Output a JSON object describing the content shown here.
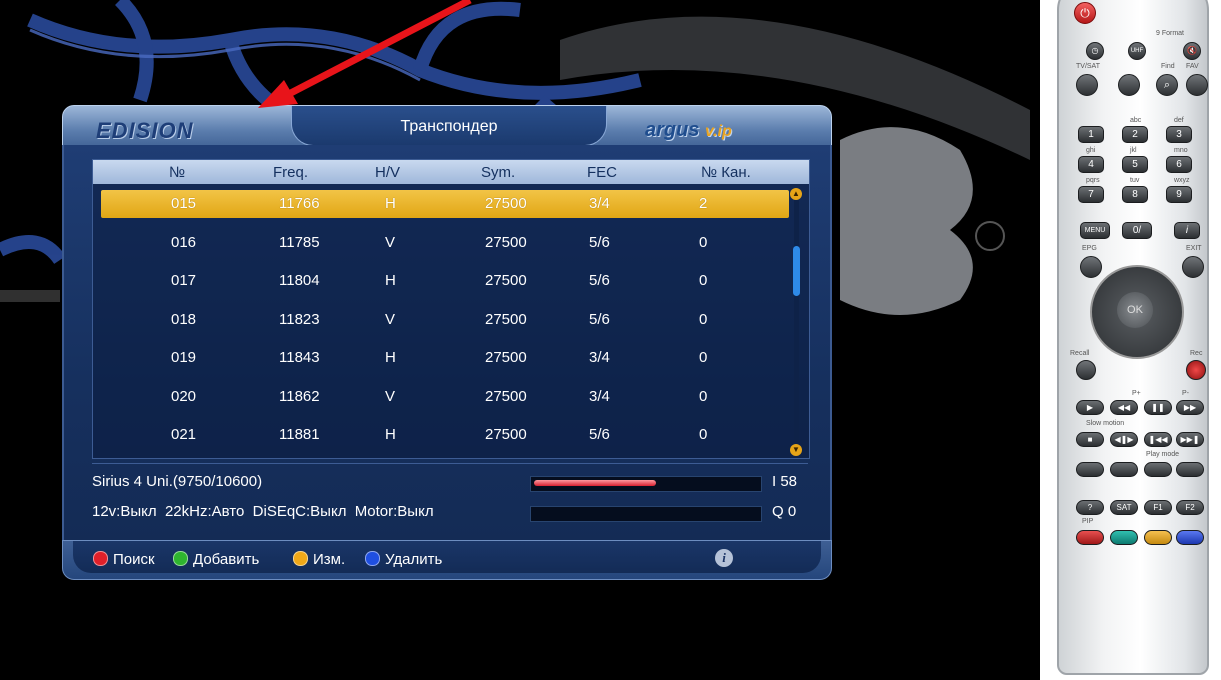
{
  "header": {
    "brand_left": "EDISION",
    "title": "Транспондер",
    "brand_right": "argus",
    "brand_right_suffix": "v.ip"
  },
  "columns": [
    "№",
    "Freq.",
    "H/V",
    "Sym.",
    "FEC",
    "№ Кан."
  ],
  "rows": [
    {
      "num": "015",
      "freq": "11766",
      "pol": "H",
      "sym": "27500",
      "fec": "3/4",
      "ch": "2",
      "selected": true
    },
    {
      "num": "016",
      "freq": "11785",
      "pol": "V",
      "sym": "27500",
      "fec": "5/6",
      "ch": "0"
    },
    {
      "num": "017",
      "freq": "11804",
      "pol": "H",
      "sym": "27500",
      "fec": "5/6",
      "ch": "0"
    },
    {
      "num": "018",
      "freq": "11823",
      "pol": "V",
      "sym": "27500",
      "fec": "5/6",
      "ch": "0"
    },
    {
      "num": "019",
      "freq": "11843",
      "pol": "H",
      "sym": "27500",
      "fec": "3/4",
      "ch": "0"
    },
    {
      "num": "020",
      "freq": "11862",
      "pol": "V",
      "sym": "27500",
      "fec": "3/4",
      "ch": "0"
    },
    {
      "num": "021",
      "freq": "11881",
      "pol": "H",
      "sym": "27500",
      "fec": "5/6",
      "ch": "0"
    }
  ],
  "info": {
    "satellite": "Sirius 4 Uni.(9750/10600)",
    "settings": "12v:Выкл  22kHz:Авто  DiSEqC:Выкл  Motor:Выкл",
    "intensity_label": "I 58",
    "quality_label": "Q 0",
    "intensity_fraction": 0.58,
    "quality_fraction": 0.0
  },
  "footer": {
    "red": "Поиск",
    "green": "Добавить",
    "yellow": "Изм.",
    "blue": "Удалить",
    "info_glyph": "i"
  },
  "colors": {
    "red": "#e0202a",
    "green": "#2fb52f",
    "yellow": "#f0a818",
    "blue": "#1f4fe0",
    "selected_row": "#e9b62c",
    "annotation_arrow": "#e8141a"
  },
  "remote": {
    "format_label": "9 Format",
    "labels_row1": [
      "TV/SAT",
      "",
      "Find",
      "FAV"
    ],
    "digit_letters": [
      "",
      "abc",
      "def",
      "ghi",
      "jkl",
      "mno",
      "pqrs",
      "tuv",
      "wxyz"
    ],
    "digits": [
      "1",
      "2",
      "3",
      "4",
      "5",
      "6",
      "7",
      "8",
      "9"
    ],
    "menu": "MENU",
    "zero": "0/",
    "info_key": "i",
    "epg": "EPG",
    "exit": "EXIT",
    "ok": "OK",
    "recall": "Recall",
    "rec": "Rec",
    "p_plus": "P+",
    "p_minus": "P-",
    "slow_motion": "Slow motion",
    "play_mode": "Play mode",
    "sat": "SAT",
    "f1": "F1",
    "f2": "F2",
    "pip": "PIP"
  }
}
